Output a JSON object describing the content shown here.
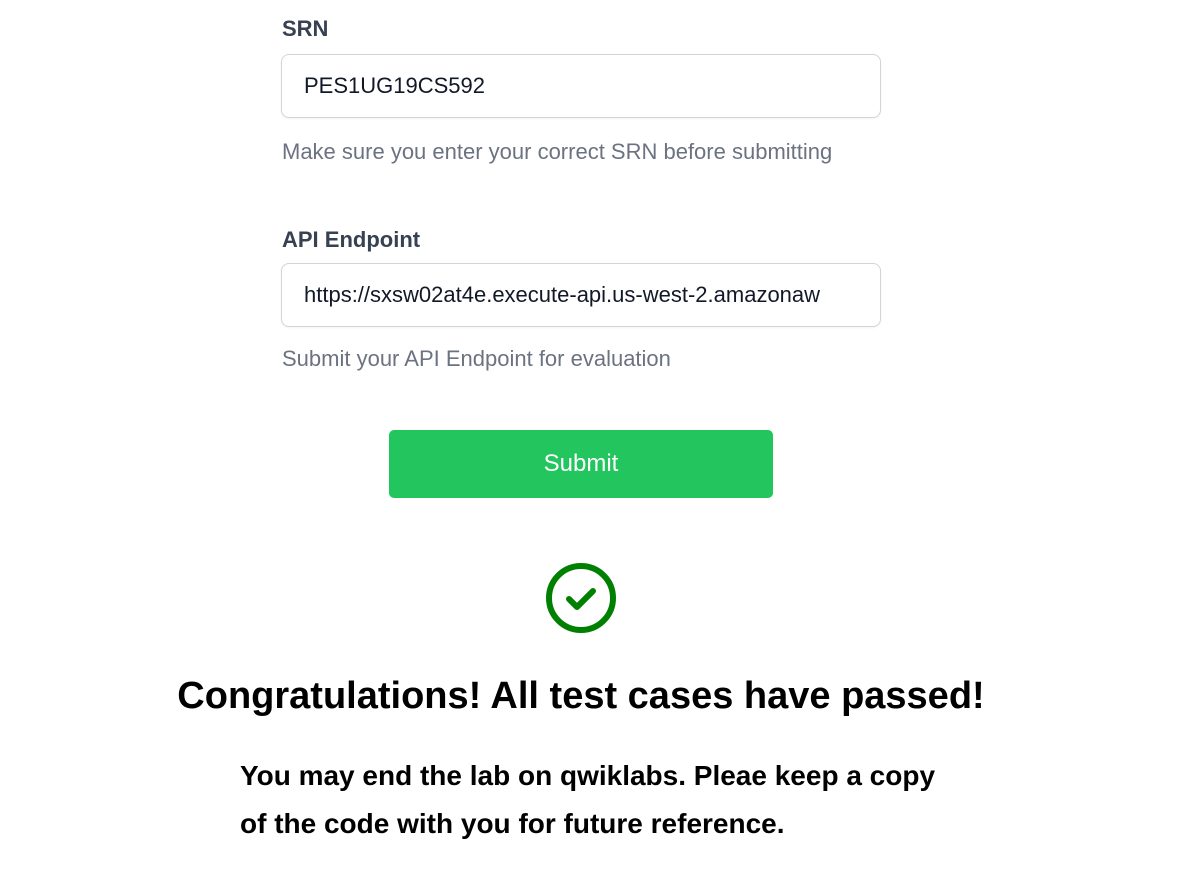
{
  "form": {
    "srn": {
      "label": "SRN",
      "value": "PES1UG19CS592",
      "help": "Make sure you enter your correct SRN before submitting"
    },
    "api": {
      "label": "API Endpoint",
      "value": "https://sxsw02at4e.execute-api.us-west-2.amazonaw",
      "help": "Submit your API Endpoint for evaluation"
    },
    "submit_label": "Submit"
  },
  "result": {
    "icon": "check-circle-icon",
    "icon_color": "#008000",
    "title": "Congratulations! All test cases have passed!",
    "message": "You may end the lab on qwiklabs. Pleae keep a copy of the code with you for future reference."
  },
  "colors": {
    "submit_button": "#22c55e",
    "success": "#008000",
    "help_text": "#6b7280"
  }
}
